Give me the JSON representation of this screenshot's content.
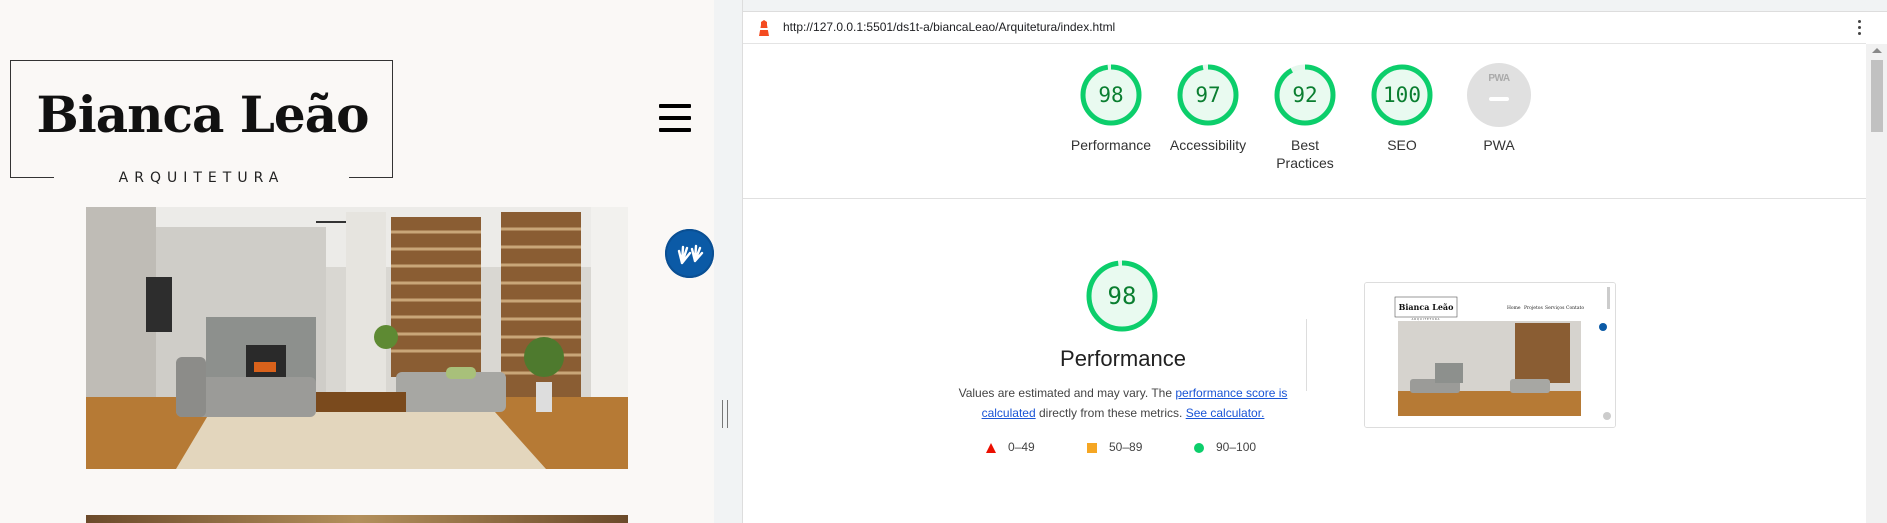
{
  "site": {
    "brand_name": "Bianca Leão",
    "brand_tagline": "ARQUITETURA",
    "menu_icon": "hamburger-icon",
    "accessibility_icon": "hand-sign-language-icon"
  },
  "lighthouse": {
    "url": "http://127.0.0.1:5501/ds1t-a/biancaLeao/Arquitetura/index.html",
    "scores": [
      {
        "value": "98",
        "label": "Performance"
      },
      {
        "value": "97",
        "label": "Accessibility"
      },
      {
        "value": "92",
        "label": "Best Practices"
      },
      {
        "value": "100",
        "label": "SEO"
      }
    ],
    "pwa": {
      "badge": "PWA",
      "label": "PWA"
    },
    "performance": {
      "score": "98",
      "title": "Performance",
      "desc_prefix": "Values are estimated and may vary. The ",
      "desc_link1": "performance score is calculated",
      "desc_middle": " directly from these metrics. ",
      "desc_link2": "See calculator."
    },
    "legend": [
      {
        "range": "0–49",
        "color": "#eb0f00",
        "shape": "triangle"
      },
      {
        "range": "50–89",
        "color": "#f5a623",
        "shape": "square"
      },
      {
        "range": "90–100",
        "color": "#0cce6b",
        "shape": "circle"
      }
    ],
    "thumbnail": {
      "brand": "Bianca Leão",
      "tagline": "ARQUITETURA",
      "nav": [
        "Home",
        "Projetos",
        "Serviços",
        "Contato"
      ]
    },
    "colors": {
      "pass": "#0cce6b",
      "pass_text": "#0a7e30",
      "link": "#1a55d6"
    }
  }
}
